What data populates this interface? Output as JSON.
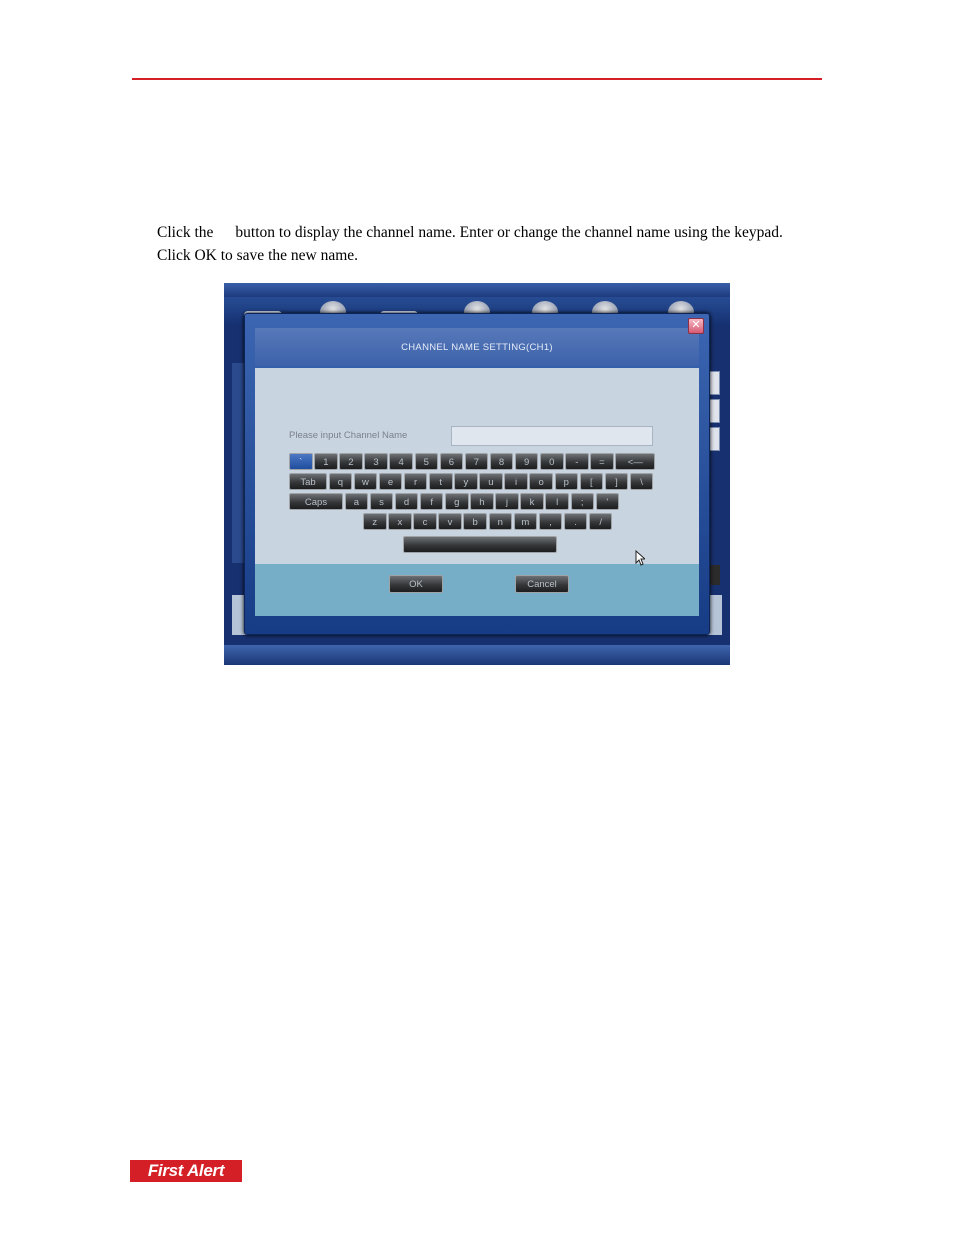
{
  "paragraph": {
    "before": "Click the",
    "after": "button to display the channel name. Enter or change the channel name using the keypad. Click OK to save the new name."
  },
  "dialog": {
    "title": "CHANNEL NAME SETTING(CH1)",
    "close_glyph": "✕",
    "field_label": "Please input Channel Name",
    "field_value": "",
    "ok_label": "OK",
    "cancel_label": "Cancel"
  },
  "keyboard": {
    "rows": [
      [
        "`",
        "1",
        "2",
        "3",
        "4",
        "5",
        "6",
        "7",
        "8",
        "9",
        "0",
        "-",
        "=",
        "<—"
      ],
      [
        "Tab",
        "q",
        "w",
        "e",
        "r",
        "t",
        "y",
        "u",
        "i",
        "o",
        "p",
        "[",
        "]",
        "\\"
      ],
      [
        "Caps",
        "a",
        "s",
        "d",
        "f",
        "g",
        "h",
        "j",
        "k",
        "l",
        ";",
        "'"
      ],
      [
        "z",
        "x",
        "c",
        "v",
        "b",
        "n",
        "m",
        ",",
        ".",
        "/"
      ],
      [
        " "
      ]
    ],
    "active_key": "`"
  },
  "logo": {
    "text": "First Alert",
    "accent": "#d41f26"
  },
  "colors": {
    "rule": "#d41f26",
    "dialog_blue": "#3c66b2",
    "panel": "#c8d4df",
    "footer": "#76aec7"
  }
}
